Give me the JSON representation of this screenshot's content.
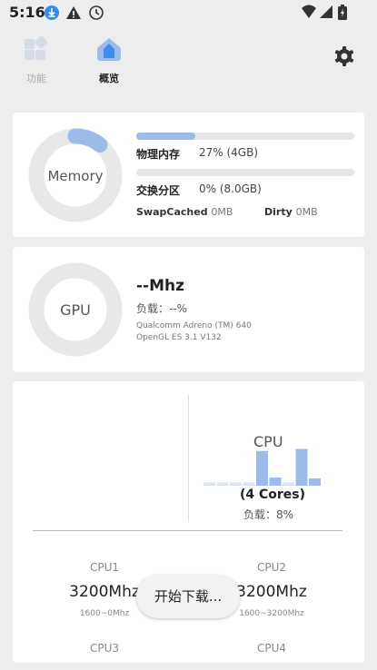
{
  "status_bar": {
    "time": "5:16"
  },
  "tabs": [
    {
      "label": "功能"
    },
    {
      "label": "概览"
    }
  ],
  "memory": {
    "ring_label": "Memory",
    "ram_label": "物理内存",
    "ram_value": "27% (4GB)",
    "ram_fraction": 0.27,
    "swap_label": "交换分区",
    "swap_value": "0% (8.0GB)",
    "swap_fraction": 0.0,
    "swapcached_label": "SwapCached",
    "swapcached_value": "0MB",
    "dirty_label": "Dirty",
    "dirty_value": "0MB"
  },
  "gpu": {
    "ring_label": "GPU",
    "freq": "--Mhz",
    "load": "负载：--%",
    "renderer": "Qualcomm Adreno (TM) 640",
    "api": "OpenGL ES 3.1 V132"
  },
  "cpu": {
    "title": "CPU",
    "cores": "(4 Cores)",
    "load": "负载：8%",
    "bar_levels": [
      0.08,
      0.08,
      0.08,
      0.08,
      0.85,
      0.2,
      0.08,
      0.9,
      0.18
    ],
    "core_list": [
      {
        "name": "CPU1",
        "freq": "3200Mhz",
        "range": "1600~0Mhz"
      },
      {
        "name": "CPU2",
        "freq": "3200Mhz",
        "range": "1600~3200Mhz"
      },
      {
        "name": "CPU3"
      },
      {
        "name": "CPU4"
      }
    ]
  },
  "toast": {
    "text": "开始下载..."
  },
  "colors": {
    "accent": "#9bbbe8",
    "icon_blue": "#3d8cf0",
    "card": "#ffffff",
    "background": "#ededed"
  }
}
